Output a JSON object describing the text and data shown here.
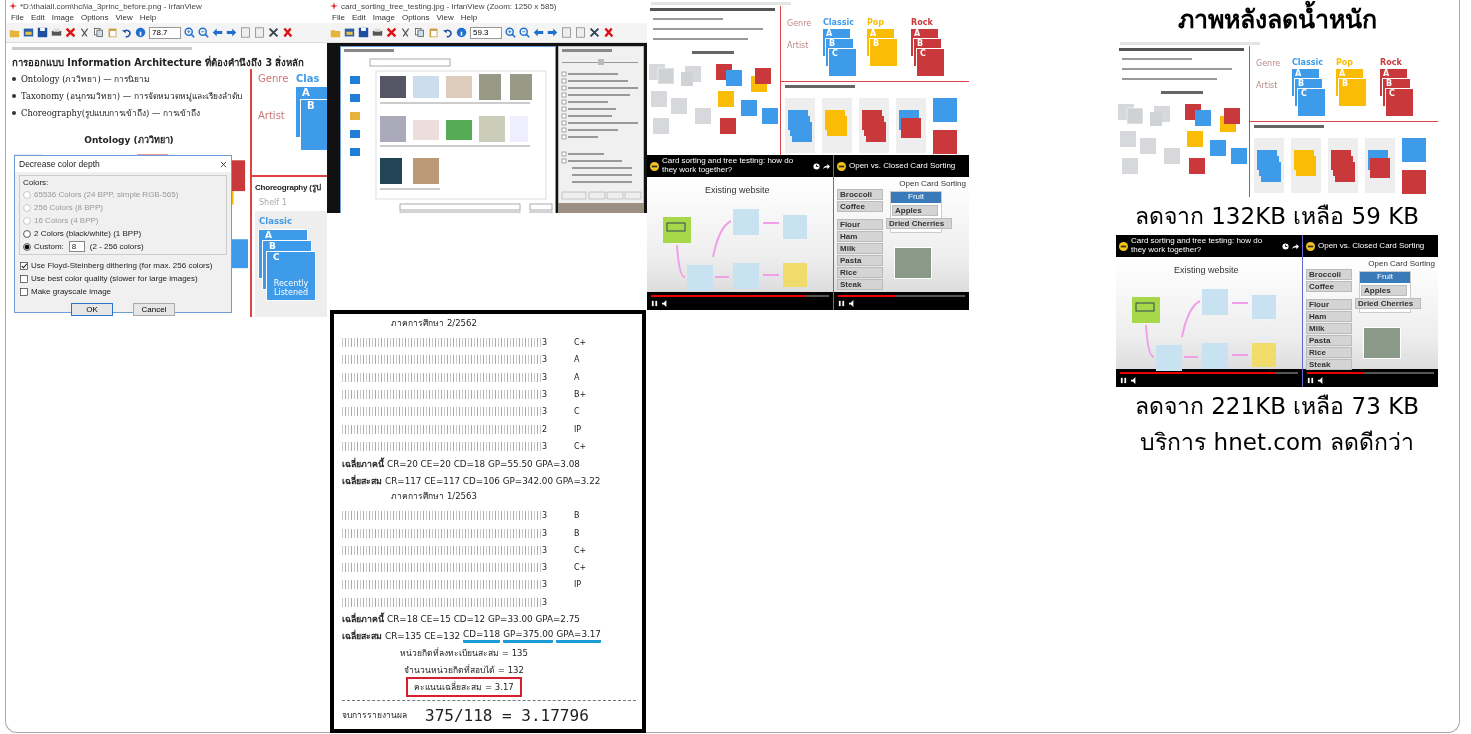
{
  "irfanview_main": {
    "title": "*D:\\thaiall.com\\hci\\ia_3princ_before.png - IrfanView",
    "menu": [
      "File",
      "Edit",
      "Image",
      "Options",
      "View",
      "Help"
    ],
    "zoom": "78.7",
    "slide": {
      "heading": "การออกแบบ Information Architecture ที่ต้องคำนึงถึง 3 สิ่งหลัก",
      "bullets": [
        "Ontology (ภววิทยา) — การนิยาม",
        "Taxonomy (อนุกรมวิทยา) — การจัดหมวดหมู่และเรียงลำดับ",
        "Choreography(รูปแบบการเข้าถึง) — การเข้าถึง"
      ],
      "ontology_title": "Ontology (ภววิทยา)",
      "row_labels": [
        "Genre",
        "Artist"
      ],
      "genres": [
        {
          "name": "Clas",
          "color": "#3d9be9",
          "cards": [
            "A",
            "B"
          ]
        }
      ],
      "choreography_title": "Choreography (รูป",
      "shelves": [
        {
          "label": "Shelf 1",
          "genre": "Classic",
          "color": "#3d9be9",
          "cards": [
            "A",
            "B",
            "C"
          ],
          "note": "Recently Listened"
        }
      ]
    },
    "dialog": {
      "title": "Decrease color depth",
      "group": "Colors:",
      "options": [
        {
          "label": "65536 Colors (24 BPP, simple RGB-565)",
          "selected": false,
          "disabled": true
        },
        {
          "label": "256 Colors (8 BPP)",
          "selected": false,
          "disabled": true
        },
        {
          "label": "16 Colors (4 BPP)",
          "selected": false,
          "disabled": true
        },
        {
          "label": "2 Colors (black/white) (1 BPP)",
          "selected": false,
          "disabled": false
        },
        {
          "label": "Custom:",
          "selected": true,
          "disabled": false
        }
      ],
      "custom_value": "8",
      "custom_hint": "(2 - 256 colors)",
      "checkboxes": [
        {
          "label": "Use Floyd-Steinberg dithering (for max. 256 colors)",
          "checked": true
        },
        {
          "label": "Use best color quality (slower for large images)",
          "checked": false
        },
        {
          "label": "Make grayscale image",
          "checked": false
        }
      ],
      "buttons": [
        "OK",
        "Cancel"
      ]
    }
  },
  "irfanview_save": {
    "title": "card_sorting_tree_testing.jpg - IrfanView (Zoom: 1250 x 585)",
    "menu": [
      "File",
      "Edit",
      "Image",
      "Options",
      "View",
      "Help"
    ],
    "zoom": "59.3"
  },
  "grade_report": {
    "terms": [
      {
        "title": "ภาคการศึกษา 2/2562",
        "rows": [
          {
            "credits": "3",
            "grade": "C+"
          },
          {
            "credits": "3",
            "grade": "A"
          },
          {
            "credits": "3",
            "grade": "A"
          },
          {
            "credits": "3",
            "grade": "B+"
          },
          {
            "credits": "3",
            "grade": "C"
          },
          {
            "credits": "2",
            "grade": "IP"
          },
          {
            "credits": "3",
            "grade": "C+"
          }
        ],
        "summaries": [
          {
            "label": "เฉลี่ยภาคนี้",
            "values": [
              {
                "text": "CR=20 CE=20 CD=18 GP=55.50 GPA=3.08",
                "underlined": false
              }
            ]
          },
          {
            "label": "เฉลี่ยสะสม",
            "values": [
              {
                "text": "CR=117 CE=117 CD=106 GP=342.00 GPA=3.22",
                "underlined": false
              }
            ]
          }
        ]
      },
      {
        "title": "ภาคการศึกษา 1/2563",
        "rows": [
          {
            "credits": "3",
            "grade": "B"
          },
          {
            "credits": "3",
            "grade": "B"
          },
          {
            "credits": "3",
            "grade": "C+"
          },
          {
            "credits": "3",
            "grade": "C+"
          },
          {
            "credits": "3",
            "grade": "IP"
          },
          {
            "credits": "3",
            "grade": ""
          }
        ],
        "summaries": [
          {
            "label": "เฉลี่ยภาคนี้",
            "values": [
              {
                "text": "CR=18 CE=15 CD=12 GP=33.00 GPA=2.75",
                "underlined": false
              }
            ]
          },
          {
            "label": "เฉลี่ยสะสม",
            "values": [
              {
                "text": "CR=135 CE=132",
                "underlined": false
              },
              {
                "text": "CD=118",
                "underlined": true
              },
              {
                "text": "GP=375.00",
                "underlined": true
              },
              {
                "text": "GPA=3.17",
                "underlined": true
              }
            ]
          }
        ]
      }
    ],
    "totals": [
      {
        "text": "หน่วยกิตที่ลงทะเบียนสะสม = 135",
        "boxed": false
      },
      {
        "text": "จำนวนหน่วยกิตที่สอบได้ = 132",
        "boxed": false
      },
      {
        "text": "คะแนนเฉลี่ยสะสม = 3.17",
        "boxed": true
      }
    ],
    "footer_label": "จบการรายงานผล",
    "result": "375/118 = 3.17796"
  },
  "ia_slide": {
    "row_labels": [
      "Genre",
      "Artist"
    ],
    "genres": [
      {
        "name": "Classic",
        "color": "#3d9be9",
        "cards": [
          "A",
          "B",
          "C"
        ]
      },
      {
        "name": "Pop",
        "color": "#fbbc05",
        "cards": [
          "A",
          "B"
        ]
      },
      {
        "name": "Rock",
        "color": "#c9393b",
        "cards": [
          "A",
          "B",
          "C"
        ]
      }
    ]
  },
  "video_pair": {
    "left": {
      "title": "Card sorting and tree testing: how do they work together?",
      "heading": "Existing website",
      "level": 0.87
    },
    "right": {
      "title": "Open vs. Closed Card Sorting",
      "heading": "Open Card Sorting",
      "cards": [
        "Broccoli",
        "Coffee",
        "Flour",
        "Ham",
        "Milk",
        "Pasta",
        "Rice",
        "Steak"
      ],
      "category": "Fruit",
      "sorted": [
        "Apples"
      ],
      "dragged": "Dried Cherries",
      "level": 0.45
    }
  },
  "after": {
    "heading": "ภาพหลังลดน้ำหนัก",
    "ia_slide": {
      "row_labels": [
        "Genre",
        "Artist"
      ],
      "genres": [
        {
          "name": "Classic",
          "color": "#3d9be9",
          "cards": [
            "A",
            "B",
            "C"
          ]
        },
        {
          "name": "Pop",
          "color": "#fbbc05",
          "cards": [
            "A",
            "B"
          ]
        },
        {
          "name": "Rock",
          "color": "#c9393b",
          "cards": [
            "A",
            "B",
            "C"
          ]
        }
      ]
    },
    "caption_1": "ลดจาก 132KB เหลือ 59 KB",
    "video_pair": {
      "left": {
        "title": "Card sorting and tree testing: how do they work together?",
        "heading": "Existing website",
        "level": 0.87
      },
      "right": {
        "title": "Open vs. Closed Card Sorting",
        "heading": "Open Card Sorting",
        "cards": [
          "Broccoli",
          "Coffee",
          "Flour",
          "Ham",
          "Milk",
          "Pasta",
          "Rice",
          "Steak"
        ],
        "category": "Fruit",
        "sorted": [
          "Apples"
        ],
        "dragged": "Dried Cherries",
        "level": 0.45
      }
    },
    "caption_2": "ลดจาก 221KB เหลือ 73 KB",
    "footer": "บริการ hnet.com ลดดีกว่า"
  }
}
